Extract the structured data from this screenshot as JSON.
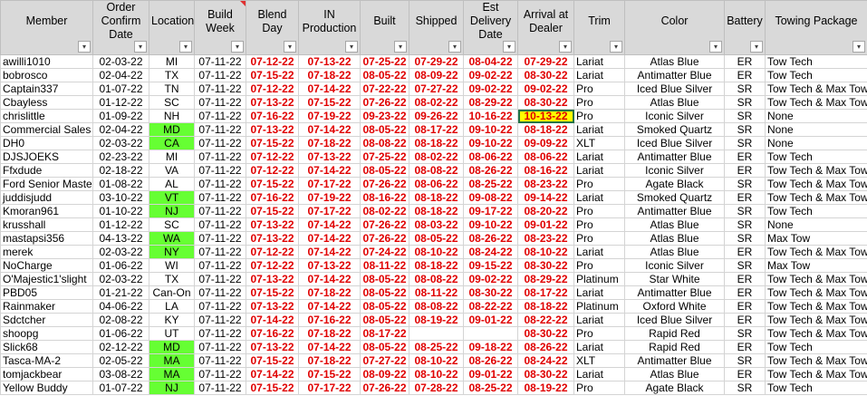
{
  "headers": [
    {
      "label": "Member",
      "filter": "sort-filter-icon"
    },
    {
      "label": "Order Confirm Date",
      "filter": "dropdown-arrow-icon"
    },
    {
      "label": "Location",
      "filter": "dropdown-arrow-icon"
    },
    {
      "label": "Build Week",
      "filter": "filter-funnel-icon"
    },
    {
      "label": "Blend Day",
      "filter": "dropdown-arrow-icon"
    },
    {
      "label": "IN Production",
      "filter": "dropdown-arrow-icon"
    },
    {
      "label": "Built",
      "filter": "dropdown-arrow-icon"
    },
    {
      "label": "Shipped",
      "filter": "dropdown-arrow-icon"
    },
    {
      "label": "Est Delivery Date",
      "filter": "dropdown-arrow-icon"
    },
    {
      "label": "Arrival at Dealer",
      "filter": "dropdown-arrow-icon"
    },
    {
      "label": "Trim",
      "filter": "dropdown-arrow-icon"
    },
    {
      "label": "Color",
      "filter": "dropdown-arrow-icon"
    },
    {
      "label": "Battery",
      "filter": "dropdown-arrow-icon"
    },
    {
      "label": "Towing Package",
      "filter": "dropdown-arrow-icon"
    }
  ],
  "rows": [
    {
      "member": "awilli1010",
      "order": "02-03-22",
      "loc": "MI",
      "week": "07-11-22",
      "blend": "07-12-22",
      "inprod": "07-13-22",
      "built": "07-25-22",
      "shipped": "07-29-22",
      "est": "08-04-22",
      "arrival": "07-29-22",
      "trim": "Lariat",
      "color": "Atlas Blue",
      "battery": "ER",
      "tow": "Tow Tech"
    },
    {
      "member": "bobrosco",
      "order": "02-04-22",
      "loc": "TX",
      "week": "07-11-22",
      "blend": "07-15-22",
      "inprod": "07-18-22",
      "built": "08-05-22",
      "shipped": "08-09-22",
      "est": "09-02-22",
      "arrival": "08-30-22",
      "trim": "Lariat",
      "color": "Antimatter Blue",
      "battery": "ER",
      "tow": "Tow Tech"
    },
    {
      "member": "Captain337",
      "order": "01-07-22",
      "loc": "TN",
      "week": "07-11-22",
      "blend": "07-12-22",
      "inprod": "07-14-22",
      "built": "07-22-22",
      "shipped": "07-27-22",
      "est": "09-02-22",
      "arrival": "09-02-22",
      "trim": "Pro",
      "color": "Iced Blue Silver",
      "battery": "SR",
      "tow": "Tow Tech & Max Tow"
    },
    {
      "member": "Cbayless",
      "order": "01-12-22",
      "loc": "SC",
      "week": "07-11-22",
      "blend": "07-13-22",
      "inprod": "07-15-22",
      "built": "07-26-22",
      "shipped": "08-02-22",
      "est": "08-29-22",
      "arrival": "08-30-22",
      "trim": "Pro",
      "color": "Atlas Blue",
      "battery": "SR",
      "tow": "Tow Tech & Max Tow"
    },
    {
      "member": "chrislittle",
      "order": "01-09-22",
      "loc": "NH",
      "week": "07-11-22",
      "blend": "07-16-22",
      "inprod": "07-19-22",
      "built": "09-23-22",
      "shipped": "09-26-22",
      "est": "10-16-22",
      "arrival": "10-13-22",
      "trim": "Pro",
      "color": "Iconic Silver",
      "battery": "SR",
      "tow": "None",
      "selected": true
    },
    {
      "member": "Commercial Sales",
      "order": "02-04-22",
      "loc": "MD",
      "week": "07-11-22",
      "blend": "07-13-22",
      "inprod": "07-14-22",
      "built": "08-05-22",
      "shipped": "08-17-22",
      "est": "09-10-22",
      "arrival": "08-18-22",
      "trim": "Lariat",
      "color": "Smoked Quartz",
      "battery": "SR",
      "tow": "None",
      "green": true
    },
    {
      "member": "DH0",
      "order": "02-03-22",
      "loc": "CA",
      "week": "07-11-22",
      "blend": "07-15-22",
      "inprod": "07-18-22",
      "built": "08-08-22",
      "shipped": "08-18-22",
      "est": "09-10-22",
      "arrival": "09-09-22",
      "trim": "XLT",
      "color": "Iced Blue Silver",
      "battery": "SR",
      "tow": "None",
      "green": true
    },
    {
      "member": "DJSJOEKS",
      "order": "02-23-22",
      "loc": "MI",
      "week": "07-11-22",
      "blend": "07-12-22",
      "inprod": "07-13-22",
      "built": "07-25-22",
      "shipped": "08-02-22",
      "est": "08-06-22",
      "arrival": "08-06-22",
      "trim": "Lariat",
      "color": "Antimatter Blue",
      "battery": "ER",
      "tow": "Tow Tech"
    },
    {
      "member": "Ffxdude",
      "order": "02-18-22",
      "loc": "VA",
      "week": "07-11-22",
      "blend": "07-12-22",
      "inprod": "07-14-22",
      "built": "08-05-22",
      "shipped": "08-08-22",
      "est": "08-26-22",
      "arrival": "08-16-22",
      "trim": "Lariat",
      "color": "Iconic Silver",
      "battery": "ER",
      "tow": "Tow Tech & Max Tow"
    },
    {
      "member": "Ford Senior Master",
      "order": "01-08-22",
      "loc": "AL",
      "week": "07-11-22",
      "blend": "07-15-22",
      "inprod": "07-17-22",
      "built": "07-26-22",
      "shipped": "08-06-22",
      "est": "08-25-22",
      "arrival": "08-23-22",
      "trim": "Pro",
      "color": "Agate Black",
      "battery": "SR",
      "tow": "Tow Tech & Max Tow"
    },
    {
      "member": "juddisjudd",
      "order": "03-10-22",
      "loc": "VT",
      "week": "07-11-22",
      "blend": "07-16-22",
      "inprod": "07-19-22",
      "built": "08-16-22",
      "shipped": "08-18-22",
      "est": "09-08-22",
      "arrival": "09-14-22",
      "trim": "Lariat",
      "color": "Smoked Quartz",
      "battery": "ER",
      "tow": "Tow Tech & Max Tow",
      "green": true
    },
    {
      "member": "Kmoran961",
      "order": "01-10-22",
      "loc": "NJ",
      "week": "07-11-22",
      "blend": "07-15-22",
      "inprod": "07-17-22",
      "built": "08-02-22",
      "shipped": "08-18-22",
      "est": "09-17-22",
      "arrival": "08-20-22",
      "trim": "Pro",
      "color": "Antimatter Blue",
      "battery": "SR",
      "tow": "Tow Tech",
      "green": true
    },
    {
      "member": "krusshall",
      "order": "01-12-22",
      "loc": "SC",
      "week": "07-11-22",
      "blend": "07-13-22",
      "inprod": "07-14-22",
      "built": "07-26-22",
      "shipped": "08-03-22",
      "est": "09-10-22",
      "arrival": "09-01-22",
      "trim": "Pro",
      "color": "Atlas Blue",
      "battery": "SR",
      "tow": "None"
    },
    {
      "member": "mastapsi356",
      "order": "04-13-22",
      "loc": "WA",
      "week": "07-11-22",
      "blend": "07-13-22",
      "inprod": "07-14-22",
      "built": "07-26-22",
      "shipped": "08-05-22",
      "est": "08-26-22",
      "arrival": "08-23-22",
      "trim": "Pro",
      "color": "Atlas Blue",
      "battery": "SR",
      "tow": "Max Tow",
      "green": true
    },
    {
      "member": "merek",
      "order": "02-03-22",
      "loc": "NY",
      "week": "07-11-22",
      "blend": "07-12-22",
      "inprod": "07-14-22",
      "built": "07-24-22",
      "shipped": "08-10-22",
      "est": "08-24-22",
      "arrival": "08-10-22",
      "trim": "Lariat",
      "color": "Atlas Blue",
      "battery": "ER",
      "tow": "Tow Tech & Max Tow",
      "green": true
    },
    {
      "member": "NoCharge",
      "order": "01-06-22",
      "loc": "WI",
      "week": "07-11-22",
      "blend": "07-12-22",
      "inprod": "07-13-22",
      "built": "08-11-22",
      "shipped": "08-18-22",
      "est": "09-15-22",
      "arrival": "08-30-22",
      "trim": "Pro",
      "color": "Iconic Silver",
      "battery": "SR",
      "tow": "Max Tow"
    },
    {
      "member": "O'Majestic1'slight",
      "order": "02-03-22",
      "loc": "TX",
      "week": "07-11-22",
      "blend": "07-13-22",
      "inprod": "07-14-22",
      "built": "08-05-22",
      "shipped": "08-08-22",
      "est": "09-02-22",
      "arrival": "08-29-22",
      "trim": "Platinum",
      "color": "Star White",
      "battery": "ER",
      "tow": "Tow Tech & Max Tow"
    },
    {
      "member": "PBD05",
      "order": "01-21-22",
      "loc": "Can-On",
      "week": "07-11-22",
      "blend": "07-15-22",
      "inprod": "07-18-22",
      "built": "08-05-22",
      "shipped": "08-11-22",
      "est": "08-30-22",
      "arrival": "08-17-22",
      "trim": "Lariat",
      "color": "Antimatter Blue",
      "battery": "ER",
      "tow": "Tow Tech & Max Tow"
    },
    {
      "member": "Rainmaker",
      "order": "04-06-22",
      "loc": "LA",
      "week": "07-11-22",
      "blend": "07-13-22",
      "inprod": "07-14-22",
      "built": "08-05-22",
      "shipped": "08-08-22",
      "est": "08-22-22",
      "arrival": "08-18-22",
      "trim": "Platinum",
      "color": "Oxford White",
      "battery": "ER",
      "tow": "Tow Tech & Max Tow"
    },
    {
      "member": "Sdctcher",
      "order": "02-08-22",
      "loc": "KY",
      "week": "07-11-22",
      "blend": "07-14-22",
      "inprod": "07-16-22",
      "built": "08-05-22",
      "shipped": "08-19-22",
      "est": "09-01-22",
      "arrival": "08-22-22",
      "trim": "Lariat",
      "color": "Iced Blue Silver",
      "battery": "ER",
      "tow": "Tow Tech & Max Tow"
    },
    {
      "member": "shoopg",
      "order": "01-06-22",
      "loc": "UT",
      "week": "07-11-22",
      "blend": "07-16-22",
      "inprod": "07-18-22",
      "built": "08-17-22",
      "shipped": "",
      "est": "",
      "arrival": "08-30-22",
      "trim": "Pro",
      "color": "Rapid Red",
      "battery": "SR",
      "tow": "Tow Tech & Max Tow"
    },
    {
      "member": "Slick68",
      "order": "02-12-22",
      "loc": "MD",
      "week": "07-11-22",
      "blend": "07-13-22",
      "inprod": "07-14-22",
      "built": "08-05-22",
      "shipped": "08-25-22",
      "est": "09-18-22",
      "arrival": "08-26-22",
      "trim": "Lariat",
      "color": "Rapid Red",
      "battery": "ER",
      "tow": "Tow Tech",
      "green": true
    },
    {
      "member": "Tasca-MA-2",
      "order": "02-05-22",
      "loc": "MA",
      "week": "07-11-22",
      "blend": "07-15-22",
      "inprod": "07-18-22",
      "built": "07-27-22",
      "shipped": "08-10-22",
      "est": "08-26-22",
      "arrival": "08-24-22",
      "trim": "XLT",
      "color": "Antimatter Blue",
      "battery": "SR",
      "tow": "Tow Tech & Max Tow",
      "green": true
    },
    {
      "member": "tomjackbear",
      "order": "03-08-22",
      "loc": "MA",
      "week": "07-11-22",
      "blend": "07-14-22",
      "inprod": "07-15-22",
      "built": "08-09-22",
      "shipped": "08-10-22",
      "est": "09-01-22",
      "arrival": "08-30-22",
      "trim": "Lariat",
      "color": "Atlas Blue",
      "battery": "ER",
      "tow": "Tow Tech & Max Tow",
      "green": true
    },
    {
      "member": "Yellow Buddy",
      "order": "01-07-22",
      "loc": "NJ",
      "week": "07-11-22",
      "blend": "07-15-22",
      "inprod": "07-17-22",
      "built": "07-26-22",
      "shipped": "07-28-22",
      "est": "08-25-22",
      "arrival": "08-19-22",
      "trim": "Pro",
      "color": "Agate Black",
      "battery": "SR",
      "tow": "Tow Tech",
      "green": true
    }
  ],
  "colors": {
    "header_bg": "#d9d9d9",
    "date_red": "#e00000",
    "location_green": "#66ff33",
    "selected_yellow": "#ffff00",
    "selection_border": "#217346"
  }
}
